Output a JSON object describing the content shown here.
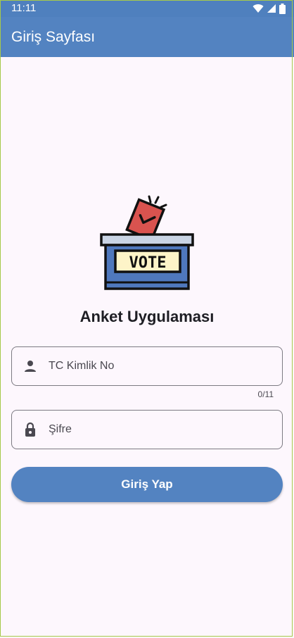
{
  "status_bar": {
    "time": "11:11",
    "icons": [
      "wifi-icon",
      "signal-icon",
      "battery-icon"
    ]
  },
  "app_bar": {
    "title": "Giriş Sayfası"
  },
  "logo": {
    "text": "VOTE"
  },
  "heading": "Anket Uygulaması",
  "form": {
    "tc_field": {
      "placeholder": "TC Kimlik No",
      "icon": "person-icon",
      "counter": "0/11"
    },
    "password_field": {
      "placeholder": "Şifre",
      "icon": "lock-icon"
    },
    "login_button": "Giriş Yap"
  },
  "colors": {
    "primary": "#5383c1",
    "background": "#fdf7fd",
    "vote_ballot": "#d9534f",
    "vote_box": "#4f78bd",
    "vote_label": "#fdf4c8"
  }
}
